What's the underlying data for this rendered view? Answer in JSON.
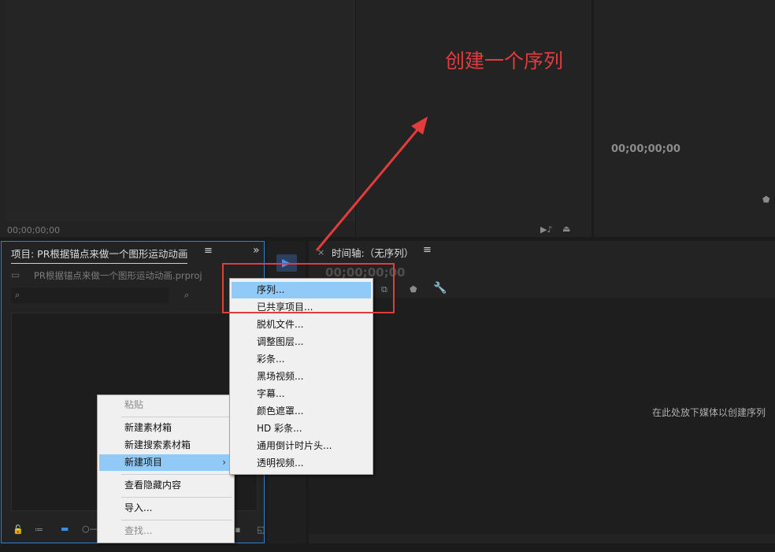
{
  "annotation": {
    "text": "创建一个序列",
    "color": "#e23c3c"
  },
  "source_monitor": {
    "timecode": "00;00;00;00"
  },
  "program_monitor": {
    "timecode": "00;00;00;00"
  },
  "project_panel": {
    "title": "项目: PR根据锚点来做一个图形运动动画",
    "file": "PR根据锚点来做一个图形运动动画.prproj",
    "search_placeholder": ""
  },
  "timeline_panel": {
    "title": "时间轴:（无序列）",
    "timecode": "00;00;00;00",
    "drop_hint": "在此处放下媒体以创建序列"
  },
  "context_menu": {
    "items": [
      {
        "label": "粘贴",
        "disabled": true
      },
      {
        "label": "新建素材箱"
      },
      {
        "label": "新建搜索素材箱"
      },
      {
        "label": "新建项目",
        "submenu": true,
        "highlighted": true
      },
      {
        "label": "查看隐藏内容"
      },
      {
        "label": "导入..."
      },
      {
        "label": "查找...",
        "disabled": true
      }
    ]
  },
  "submenu": {
    "items": [
      {
        "label": "序列...",
        "highlighted": true
      },
      {
        "label": "已共享项目..."
      },
      {
        "label": "脱机文件..."
      },
      {
        "label": "调整图层..."
      },
      {
        "label": "彩条..."
      },
      {
        "label": "黑场视频..."
      },
      {
        "label": "字幕..."
      },
      {
        "label": "颜色遮罩..."
      },
      {
        "label": "HD 彩条..."
      },
      {
        "label": "通用倒计时片头..."
      },
      {
        "label": "透明视频..."
      }
    ]
  },
  "colors": {
    "accent": "#91c9f7",
    "panel_focus": "#2d7fd6",
    "annotation": "#e23c3c"
  }
}
